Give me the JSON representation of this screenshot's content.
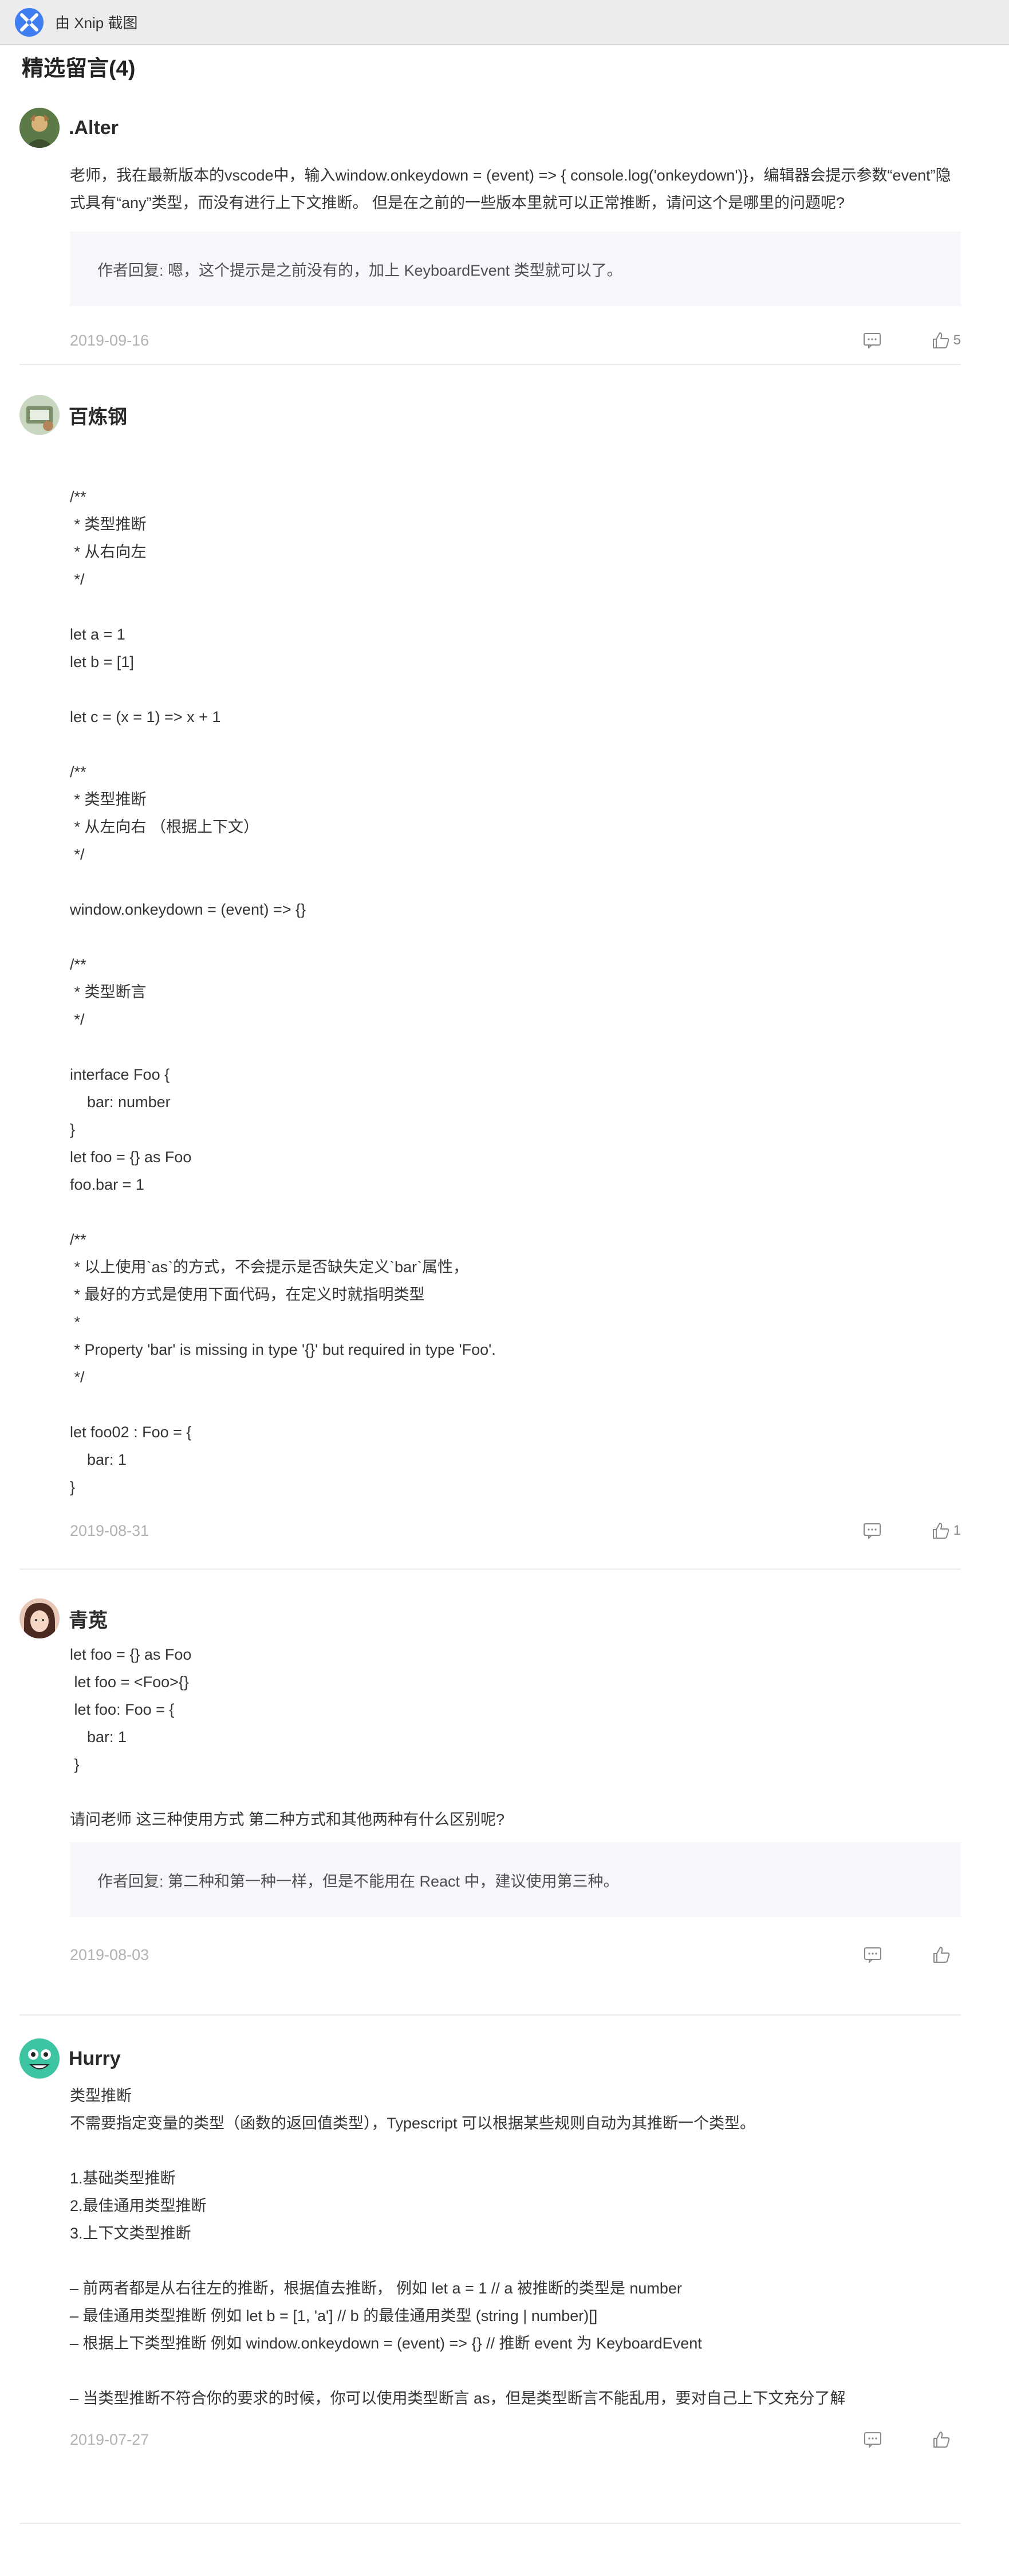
{
  "topbar": {
    "title": "由 Xnip 截图"
  },
  "section": {
    "title": "精选留言(4)"
  },
  "colors": {
    "accent": "#3e7ef0",
    "reply_bg": "#f6f7fb",
    "date": "#b2b2b2"
  },
  "comments": [
    {
      "user": ".Alter",
      "avatar_icon": "user-avatar-icon",
      "body": "老师，我在最新版本的vscode中，输入window.onkeydown = (event) => { console.log('onkeydown')}，编辑器会提示参数“event”隐式具有“any”类型，而没有进行上下文推断。 但是在之前的一些版本里就可以正常推断，请问这个是哪里的问题呢?",
      "reply": "作者回复: 嗯，这个提示是之前没有的，加上 KeyboardEvent 类型就可以了。",
      "date": "2019-09-16",
      "likes": "5"
    },
    {
      "user": "百炼钢",
      "avatar_icon": "user-avatar-icon",
      "body": "\n/**\n * 类型推断\n * 从右向左\n */\n\nlet a = 1\nlet b = [1]\n\nlet c = (x = 1) => x + 1\n\n/**\n * 类型推断\n * 从左向右 （根据上下文）\n */\n\nwindow.onkeydown = (event) => {}\n\n/**\n * 类型断言\n */\n\ninterface Foo {\n    bar: number\n}\nlet foo = {} as Foo\nfoo.bar = 1\n\n/**\n * 以上使用`as`的方式，不会提示是否缺失定义`bar`属性，\n * 最好的方式是使用下面代码，在定义时就指明类型\n *\n * Property 'bar' is missing in type '{}' but required in type 'Foo'.\n */\n\nlet foo02 : Foo = {\n    bar: 1\n}",
      "reply": "",
      "date": "2019-08-31",
      "likes": "1"
    },
    {
      "user": "青莵",
      "avatar_icon": "user-avatar-icon",
      "body": "let foo = {} as Foo\n let foo = <Foo>{}\n let foo: Foo = {\n    bar: 1\n }\n\n请问老师 这三种使用方式 第二种方式和其他两种有什么区别呢?",
      "reply": "作者回复: 第二种和第一种一样，但是不能用在 React 中，建议使用第三种。",
      "date": "2019-08-03",
      "likes": ""
    },
    {
      "user": "Hurry",
      "avatar_icon": "user-avatar-icon",
      "body": "类型推断\n不需要指定变量的类型（函数的返回值类型），Typescript 可以根据某些规则自动为其推断一个类型。\n\n1.基础类型推断\n2.最佳通用类型推断\n3.上下文类型推断\n\n– 前两者都是从右往左的推断，根据值去推断， 例如 let a = 1 // a 被推断的类型是 number\n– 最佳通用类型推断 例如 let b = [1, 'a'] // b 的最佳通用类型 (string | number)[]\n– 根据上下类型推断 例如 window.onkeydown = (event) => {} // 推断 event 为 KeyboardEvent\n\n– 当类型推断不符合你的要求的时候，你可以使用类型断言 as，但是类型断言不能乱用，要对自己上下文充分了解",
      "reply": "",
      "date": "2019-07-27",
      "likes": ""
    }
  ]
}
